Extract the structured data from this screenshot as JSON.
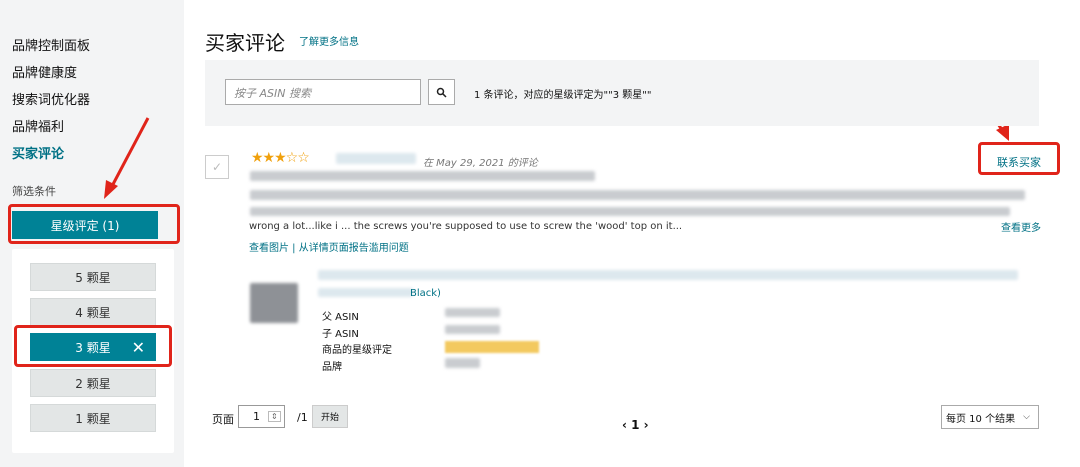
{
  "sidebar": {
    "nav_items": [
      "品牌控制面板",
      "品牌健康度",
      "搜索词优化器",
      "品牌福利",
      "买家评论"
    ],
    "filter_title": "筛选条件",
    "rating_filter_label": "星级评定 (1)",
    "star_options": [
      "5 颗星",
      "4 颗星",
      "3 颗星",
      "2 颗星",
      "1 颗星"
    ],
    "selected_close": "✕"
  },
  "header": {
    "title": "买家评论",
    "learn_more": "了解更多信息"
  },
  "search": {
    "placeholder": "按子 ASIN 搜索",
    "result_text": "1 条评论，对应的星级评定为\"\"3 颗星\"\""
  },
  "review": {
    "stars": "★★★☆☆",
    "date": "在 May 29, 2021 的评论",
    "contact_label": "联系买家",
    "line_text": "wrong a lot...like i ... the screws you're supposed to use to screw the 'wood' top on it...",
    "more_label": "查看更多",
    "links": "查看图片 | 从详情页面报告滥用问题",
    "product_suffix": "Black)",
    "attributes": [
      "父 ASIN",
      "子 ASIN",
      "商品的星级评定",
      "品牌"
    ]
  },
  "pagination": {
    "page_label": "页面",
    "page_value": "1",
    "total": "/1",
    "start_label": "开始",
    "nav": "‹  1  ›",
    "per_page": "每页 10 个结果"
  },
  "colors": {
    "accent": "#008296",
    "link": "#007185",
    "annotation": "#e0241a",
    "star": "#f0a00c"
  }
}
